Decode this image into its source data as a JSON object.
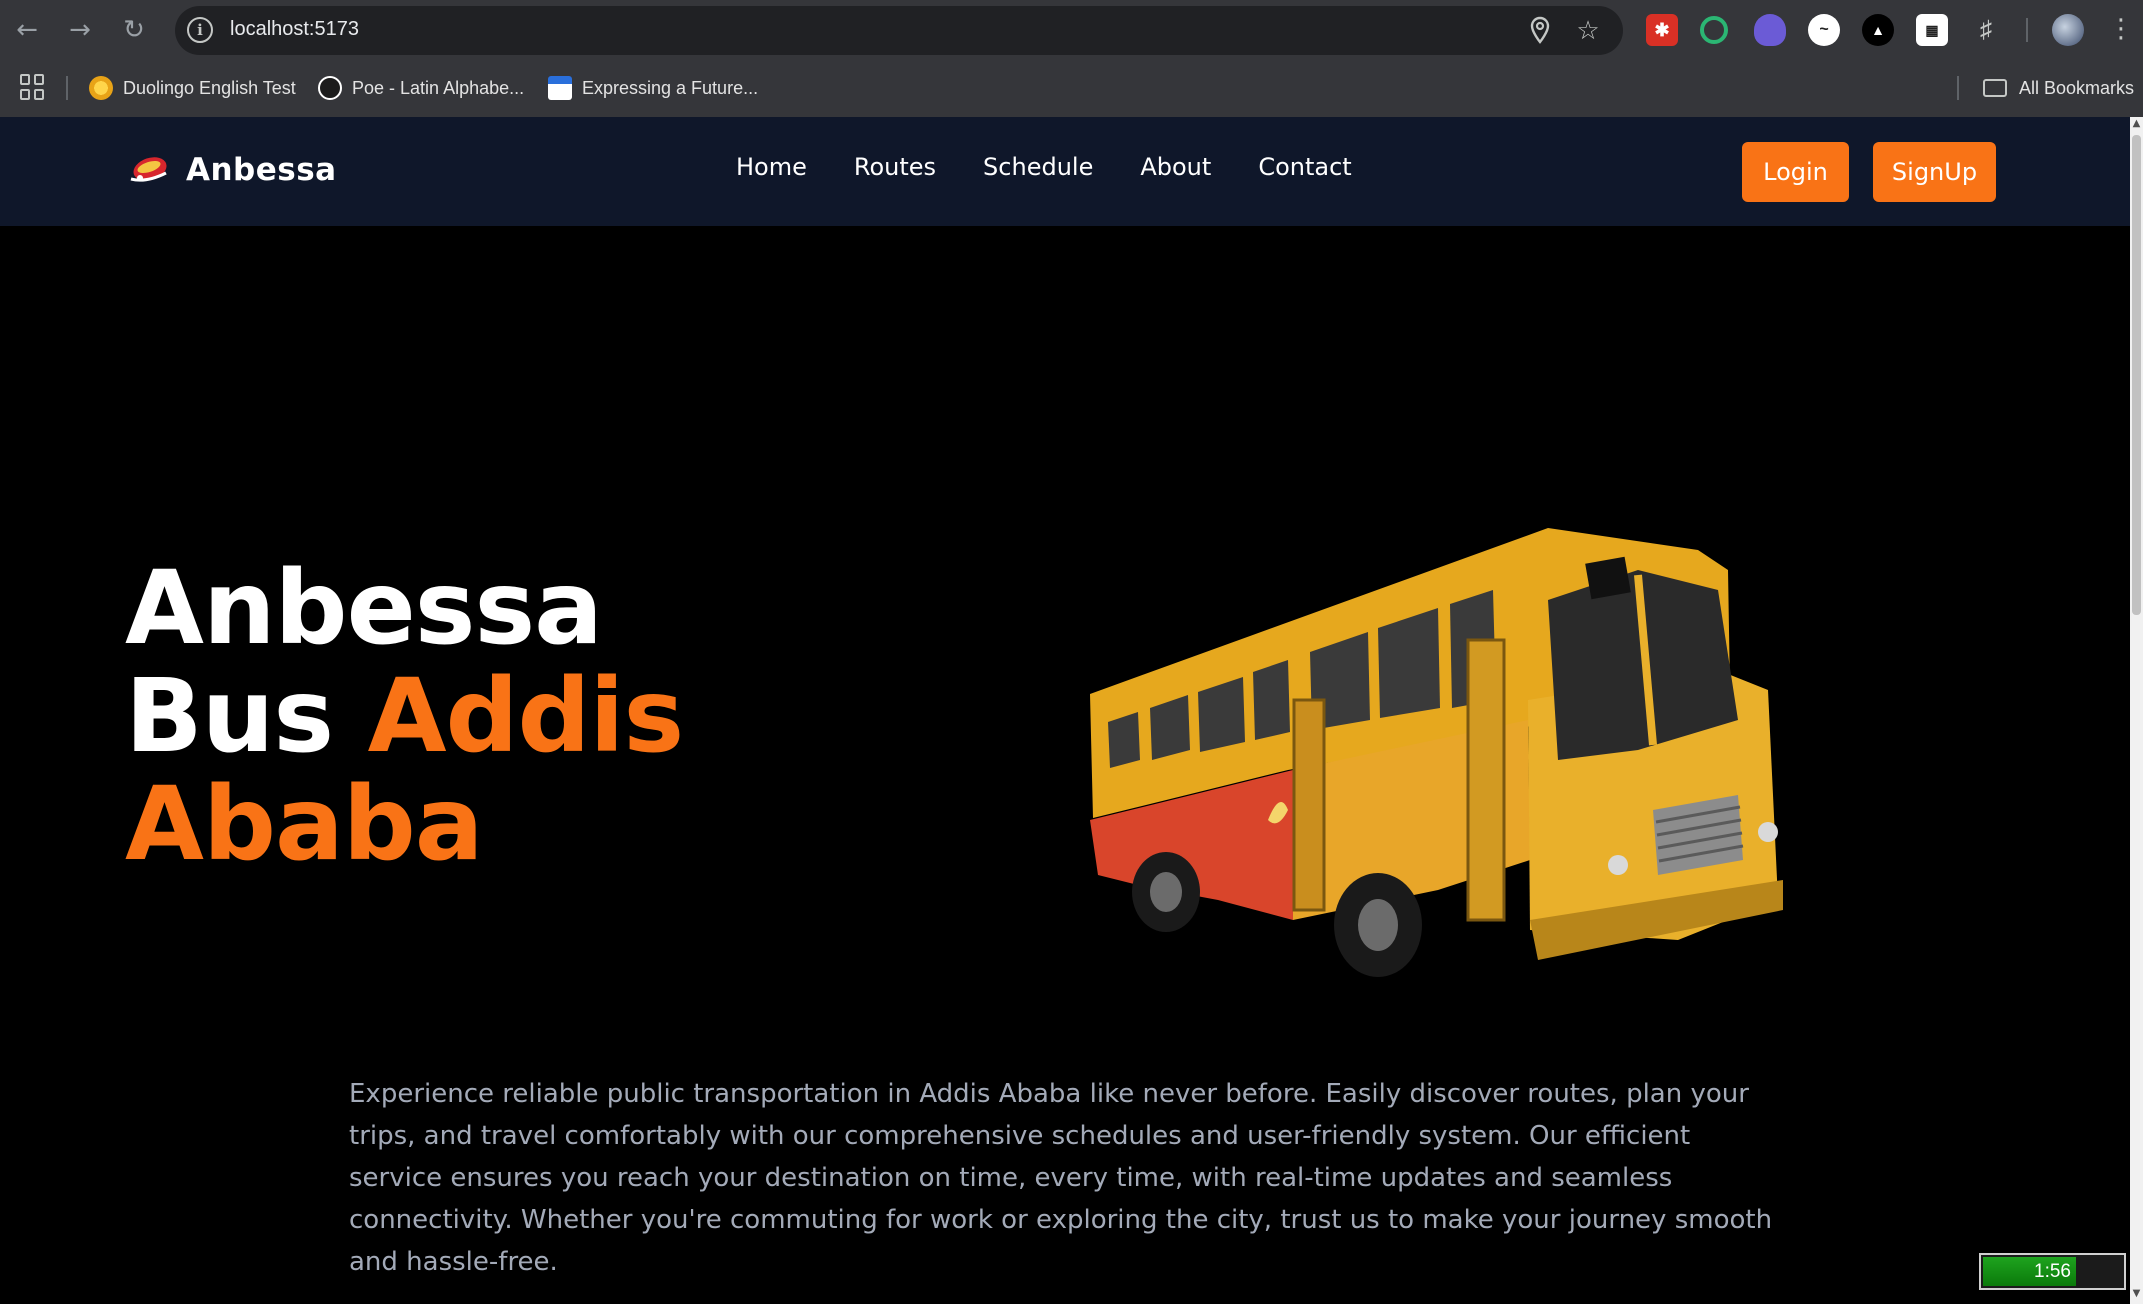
{
  "browser": {
    "url": "localhost:5173",
    "bookmarks": [
      {
        "label": "Duolingo English Test",
        "icon": "duolingo-icon"
      },
      {
        "label": "Poe - Latin Alphabe...",
        "icon": "poe-icon"
      },
      {
        "label": "Expressing a Future...",
        "icon": "page-icon"
      }
    ],
    "all_bookmarks_label": "All Bookmarks"
  },
  "navbar": {
    "brand": "Anbessa",
    "links": [
      "Home",
      "Routes",
      "Schedule",
      "About",
      "Contact"
    ],
    "login_label": "Login",
    "signup_label": "SignUp",
    "accent_color": "#f97316",
    "background_color": "#0f172a"
  },
  "hero": {
    "title_line1": "Anbessa",
    "title_line2_white": "Bus",
    "title_line2_accent": "Addis",
    "title_line3_accent": "Ababa",
    "description": "Experience reliable public transportation in Addis Ababa like never before. Easily discover routes, plan your trips, and travel comfortably with our comprehensive schedules and user-friendly system. Our efficient service ensures you reach your destination on time, every time, with real-time updates and seamless connectivity. Whether you're commuting for work or exploring the city, trust us to make your journey smooth and hassle-free.",
    "image": "bus-image"
  },
  "timer": {
    "label": "1:56",
    "progress": 0.65
  }
}
